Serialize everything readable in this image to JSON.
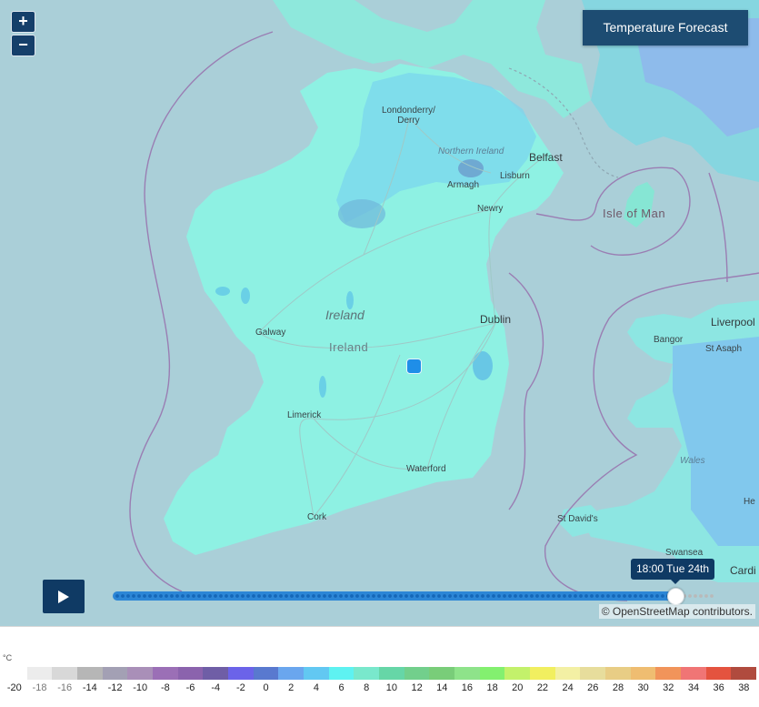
{
  "map": {
    "title_button": "Temperature Forecast",
    "zoom_in": "+",
    "zoom_out": "−",
    "attribution": "© OpenStreetMap contributors.",
    "time_label": "18:00 Tue 24th",
    "timeline_progress_fraction": 0.93,
    "place_labels": {
      "londonderry": "Londonderry/\nDerry",
      "northern_ireland": "Northern Ireland",
      "belfast": "Belfast",
      "lisburn": "Lisburn",
      "armagh": "Armagh",
      "newry": "Newry",
      "isle_of_man": "Isle of Man",
      "ireland_italic": "Ireland",
      "ireland": "Ireland",
      "dublin": "Dublin",
      "galway": "Galway",
      "limerick": "Limerick",
      "waterford": "Waterford",
      "cork": "Cork",
      "liverpool": "Liverpool",
      "bangor": "Bangor",
      "st_asaph": "St Asaph",
      "wales": "Wales",
      "st_davids": "St David's",
      "swansea": "Swansea",
      "cardiff": "Cardi",
      "hereford": "He"
    }
  },
  "legend": {
    "unit": "°C",
    "stops": [
      {
        "label": "-20",
        "color": "#ffffff"
      },
      {
        "label": "-18",
        "color": "#ececec"
      },
      {
        "label": "-16",
        "color": "#d8d8d8"
      },
      {
        "label": "-14",
        "color": "#b6b6b6"
      },
      {
        "label": "-12",
        "color": "#a3a0b4"
      },
      {
        "label": "-10",
        "color": "#a98fb8"
      },
      {
        "label": "-8",
        "color": "#9b6fb6"
      },
      {
        "label": "-6",
        "color": "#8b63ad"
      },
      {
        "label": "-4",
        "color": "#6f5ea6"
      },
      {
        "label": "-2",
        "color": "#6b63e9"
      },
      {
        "label": "0",
        "color": "#5979cf"
      },
      {
        "label": "2",
        "color": "#6aa6ee"
      },
      {
        "label": "4",
        "color": "#62c8f2"
      },
      {
        "label": "6",
        "color": "#5ef2f1"
      },
      {
        "label": "8",
        "color": "#79e8cc"
      },
      {
        "label": "10",
        "color": "#66d6a7"
      },
      {
        "label": "12",
        "color": "#72cf8c"
      },
      {
        "label": "14",
        "color": "#79cd79"
      },
      {
        "label": "16",
        "color": "#8ee38a"
      },
      {
        "label": "18",
        "color": "#83f06f"
      },
      {
        "label": "20",
        "color": "#c3f16b"
      },
      {
        "label": "22",
        "color": "#f1ef60"
      },
      {
        "label": "24",
        "color": "#f3f0a4"
      },
      {
        "label": "26",
        "color": "#e7dd9c"
      },
      {
        "label": "28",
        "color": "#e8cd85"
      },
      {
        "label": "30",
        "color": "#efbd71"
      },
      {
        "label": "32",
        "color": "#f1945a"
      },
      {
        "label": "34",
        "color": "#f07575"
      },
      {
        "label": "36",
        "color": "#e4533f"
      },
      {
        "label": "38",
        "color": "#b04b3e"
      }
    ]
  }
}
